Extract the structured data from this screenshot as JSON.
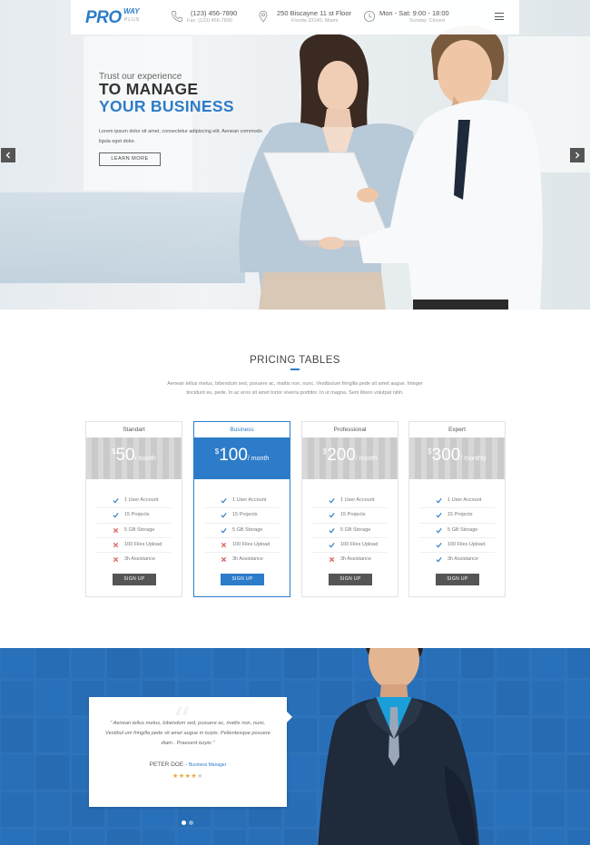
{
  "header": {
    "logo": {
      "pro": "PRO",
      "way": "WAY",
      "plus": "PLUS"
    },
    "phone": {
      "line1": "(123) 456-7890",
      "line2": "Fax: (123) 456-7890"
    },
    "address": {
      "line1": "250 Biscayne 11 st Floor",
      "line2": "Florida 33140, Miami"
    },
    "hours": {
      "line1": "Mon - Sat: 9:00 - 18:00",
      "line2": "Sunday: Closed"
    },
    "icons": {
      "phone": "phone-icon",
      "location": "map-pin-icon",
      "clock": "clock-icon",
      "menu": "hamburger-menu-icon"
    }
  },
  "hero": {
    "subtitle": "Trust our experience",
    "title_line1": "TO MANAGE",
    "title_line2": "YOUR BUSINESS",
    "description": "Lorem ipsum dolor sit amet, consectetur adipiscing elit. Aenean commodo ligula eget dolor.",
    "button": "LEARN MORE",
    "arrows": {
      "prev": "chevron-left-icon",
      "next": "chevron-right-icon"
    }
  },
  "pricing": {
    "title": "PRICING TABLES",
    "description": "Aenean tellus metus, bibendum sed, posuere ac, mattis non, nunc. Vestibulum fringilla pede sit amet augue. Integer tincidunt eu, pede. In ac eros sit amet tortor viverra porttitor. In ut magna. Sem libero volutpat nibh.",
    "plans": [
      {
        "name": "Standart",
        "currency": "$",
        "price": "50",
        "period": "/ month",
        "signup": "SIGN UP",
        "features": [
          {
            "text": "1 User Account",
            "included": true
          },
          {
            "text": "15 Projects",
            "included": true
          },
          {
            "text": "5 GB Storage",
            "included": false
          },
          {
            "text": "100 Files Upload",
            "included": false
          },
          {
            "text": "3h Assistance",
            "included": false
          }
        ]
      },
      {
        "name": "Business",
        "currency": "$",
        "price": "100",
        "period": "/ month",
        "signup": "SIGN UP",
        "features": [
          {
            "text": "1 User Account",
            "included": true
          },
          {
            "text": "15 Projects",
            "included": true
          },
          {
            "text": "5 GB Storage",
            "included": true
          },
          {
            "text": "100 Files Upload",
            "included": false
          },
          {
            "text": "3h Assistance",
            "included": false
          }
        ]
      },
      {
        "name": "Professional",
        "currency": "$",
        "price": "200",
        "period": "/ month",
        "signup": "SIGN UP",
        "features": [
          {
            "text": "1 User Account",
            "included": true
          },
          {
            "text": "15 Projects",
            "included": true
          },
          {
            "text": "5 GB Storage",
            "included": true
          },
          {
            "text": "100 Files Upload",
            "included": true
          },
          {
            "text": "3h Assistance",
            "included": false
          }
        ]
      },
      {
        "name": "Expert",
        "currency": "$",
        "price": "300",
        "period": "/ monthly",
        "signup": "SIGN UP",
        "features": [
          {
            "text": "1 User Account",
            "included": true
          },
          {
            "text": "15 Projects",
            "included": true
          },
          {
            "text": "5 GB Storage",
            "included": true
          },
          {
            "text": "100 Files Upload",
            "included": true
          },
          {
            "text": "3h Assistance",
            "included": true
          }
        ]
      }
    ]
  },
  "testimonial": {
    "quote": "\" Aenean tellus metus, bibendum sed, posuere ac, mattis non, nunc. Vestibul um fringilla pede sit amet augue in turpis. Pellentesque posuere diam . Praesent turpis \"",
    "name": "PETER DOE",
    "separator": "-",
    "role": "Business Manager",
    "rating": 4,
    "rating_max": 5,
    "slides": 2,
    "active_slide": 1
  },
  "colors": {
    "brand_blue": "#2d7cc9",
    "dark_button": "#555555",
    "star": "#e8a93a",
    "check": "#2d7cc9",
    "cross": "#d9534f"
  }
}
